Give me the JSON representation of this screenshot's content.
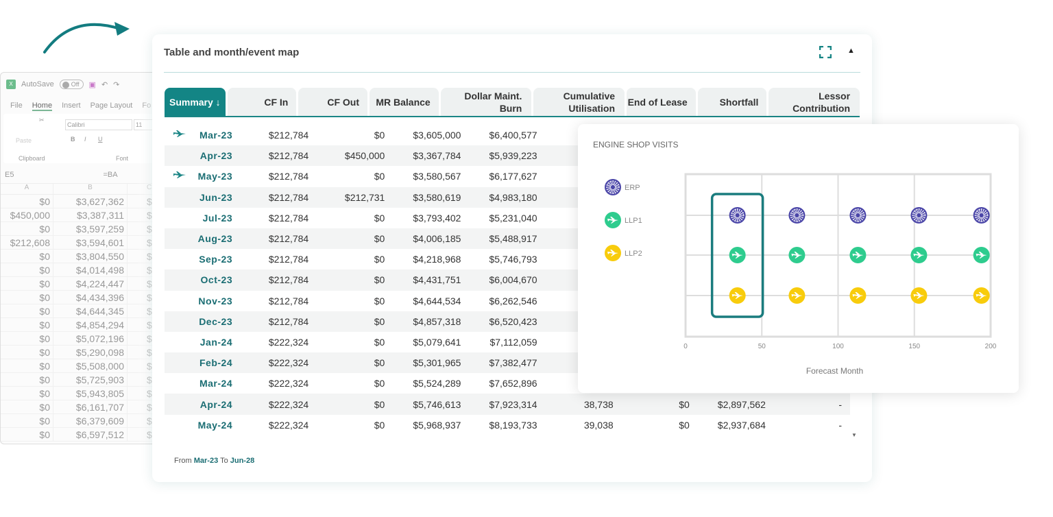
{
  "excel": {
    "autosave_label": "AutoSave",
    "autosave_state": "Off",
    "menu": [
      "File",
      "Home",
      "Insert",
      "Page Layout",
      "Fo"
    ],
    "font_name": "Calibri",
    "font_size": "11",
    "paste_label": "Paste",
    "group_clipboard": "Clipboard",
    "group_font": "Font",
    "cell_ref": "E5",
    "formula": "=BA",
    "col_headers": [
      "A",
      "B",
      "C"
    ],
    "rows": [
      [
        "$0",
        "$3,627,362",
        "$"
      ],
      [
        "$450,000",
        "$3,387,311",
        "$"
      ],
      [
        "$0",
        "$3,597,259",
        "$"
      ],
      [
        "$212,608",
        "$3,594,601",
        "$"
      ],
      [
        "$0",
        "$3,804,550",
        "$"
      ],
      [
        "$0",
        "$4,014,498",
        "$"
      ],
      [
        "$0",
        "$4,224,447",
        "$"
      ],
      [
        "$0",
        "$4,434,396",
        "$"
      ],
      [
        "$0",
        "$4,644,345",
        "$"
      ],
      [
        "$0",
        "$4,854,294",
        "$"
      ],
      [
        "$0",
        "$5,072,196",
        "$"
      ],
      [
        "$0",
        "$5,290,098",
        "$"
      ],
      [
        "$0",
        "$5,508,000",
        "$"
      ],
      [
        "$0",
        "$5,725,903",
        "$"
      ],
      [
        "$0",
        "$5,943,805",
        "$"
      ],
      [
        "$0",
        "$6,161,707",
        "$"
      ],
      [
        "$0",
        "$6,379,609",
        "$"
      ],
      [
        "$0",
        "$6,597,512",
        "$"
      ]
    ]
  },
  "panel": {
    "title": "Table and month/event map",
    "headers": [
      "Summary ↓",
      "CF In",
      "CF Out",
      "MR Balance",
      "Dollar Maint. Burn",
      "Cumulative Utilisation",
      "End of Lease",
      "Shortfall",
      "Lessor Contribution"
    ],
    "rows": [
      {
        "month": "Mar-23",
        "event": true,
        "cells": [
          "$212,784",
          "$0",
          "$3,605,000",
          "$6,400,577",
          "",
          "",
          "",
          ""
        ]
      },
      {
        "month": "Apr-23",
        "event": false,
        "cells": [
          "$212,784",
          "$450,000",
          "$3,367,784",
          "$5,939,223",
          "",
          "",
          "",
          ""
        ]
      },
      {
        "month": "May-23",
        "event": true,
        "cells": [
          "$212,784",
          "$0",
          "$3,580,567",
          "$6,177,627",
          "",
          "",
          "",
          ""
        ]
      },
      {
        "month": "Jun-23",
        "event": false,
        "cells": [
          "$212,784",
          "$212,731",
          "$3,580,619",
          "$4,983,180",
          "",
          "",
          "",
          ""
        ]
      },
      {
        "month": "Jul-23",
        "event": false,
        "cells": [
          "$212,784",
          "$0",
          "$3,793,402",
          "$5,231,040",
          "",
          "",
          "",
          ""
        ]
      },
      {
        "month": "Aug-23",
        "event": false,
        "cells": [
          "$212,784",
          "$0",
          "$4,006,185",
          "$5,488,917",
          "",
          "",
          "",
          ""
        ]
      },
      {
        "month": "Sep-23",
        "event": false,
        "cells": [
          "$212,784",
          "$0",
          "$4,218,968",
          "$5,746,793",
          "",
          "",
          "",
          ""
        ]
      },
      {
        "month": "Oct-23",
        "event": false,
        "cells": [
          "$212,784",
          "$0",
          "$4,431,751",
          "$6,004,670",
          "",
          "",
          "",
          ""
        ]
      },
      {
        "month": "Nov-23",
        "event": false,
        "cells": [
          "$212,784",
          "$0",
          "$4,644,534",
          "$6,262,546",
          "",
          "",
          "",
          ""
        ]
      },
      {
        "month": "Dec-23",
        "event": false,
        "cells": [
          "$212,784",
          "$0",
          "$4,857,318",
          "$6,520,423",
          "",
          "",
          "",
          ""
        ]
      },
      {
        "month": "Jan-24",
        "event": false,
        "cells": [
          "$222,324",
          "$0",
          "$5,079,641",
          "$7,112,059",
          "",
          "",
          "",
          ""
        ]
      },
      {
        "month": "Feb-24",
        "event": false,
        "cells": [
          "$222,324",
          "$0",
          "$5,301,965",
          "$7,382,477",
          "",
          "",
          "",
          ""
        ]
      },
      {
        "month": "Mar-24",
        "event": false,
        "cells": [
          "$222,324",
          "$0",
          "$5,524,289",
          "$7,652,896",
          "",
          "",
          "",
          ""
        ]
      },
      {
        "month": "Apr-24",
        "event": false,
        "cells": [
          "$222,324",
          "$0",
          "$5,746,613",
          "$7,923,314",
          "38,738",
          "$0",
          "$2,897,562",
          "-"
        ]
      },
      {
        "month": "May-24",
        "event": false,
        "cells": [
          "$222,324",
          "$0",
          "$5,968,937",
          "$8,193,733",
          "39,038",
          "$0",
          "$2,937,684",
          "-"
        ]
      }
    ],
    "footer": {
      "from_label": "From",
      "from": "Mar-23",
      "to_label": "To",
      "to": "Jun-28"
    }
  },
  "chart_data": {
    "type": "scatter",
    "title": "ENGINE SHOP VISITS",
    "xlabel": "Forecast Month",
    "xlim": [
      0,
      200
    ],
    "xticks": [
      0,
      50,
      100,
      150,
      200
    ],
    "grid": true,
    "legend_placement": "left",
    "series": [
      {
        "name": "ERP",
        "icon": "engine-icon",
        "color": "#4b46a8",
        "x": [
          34,
          73,
          113,
          153,
          194
        ]
      },
      {
        "name": "LLP1",
        "icon": "airplane-icon",
        "color": "#2ecc8e",
        "x": [
          34,
          73,
          113,
          153,
          194
        ]
      },
      {
        "name": "LLP2",
        "icon": "airplane-icon",
        "color": "#f8cc0c",
        "x": [
          34,
          73,
          113,
          153,
          194
        ]
      }
    ],
    "highlight_x": 34,
    "accent": "#1a7c7e"
  }
}
